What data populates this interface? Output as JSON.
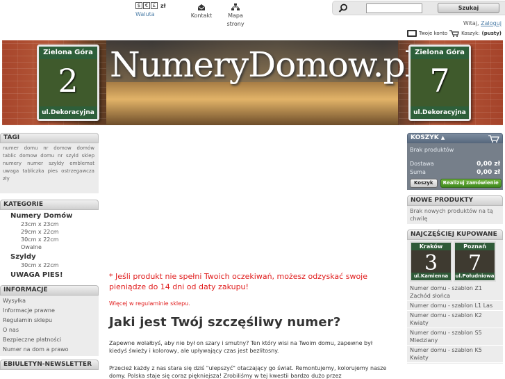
{
  "topbar": {
    "currency_symbols": [
      "$",
      "€",
      "£"
    ],
    "currency_active": "zł",
    "currency_label": "Waluta",
    "kontakt_label": "Kontakt",
    "mapa_line1": "Mapa",
    "mapa_line2": "strony",
    "search_placeholder": "",
    "search_button": "Szukaj",
    "welcome_text": "Witaj,",
    "login_link": "Zaloguj",
    "account_link": "Twoje konto",
    "cart_label": "Koszyk:",
    "cart_status": "(pusty)"
  },
  "banner": {
    "title": "NumeryDomow.pl",
    "left_plate": {
      "city": "Zielona Góra",
      "number": "2",
      "street": "ul.Dekoracyjna"
    },
    "right_plate": {
      "city": "Zielona Góra",
      "number": "7",
      "street": "ul.Dekoracyjna"
    }
  },
  "tags": {
    "title": "TAGI",
    "items": [
      "numer",
      "domu",
      "nr",
      "domow",
      "domów",
      "tablic",
      "domow",
      "domu",
      "nr",
      "szyld",
      "sklep",
      "numery",
      "numer",
      "szyldy",
      "emblemat",
      "uwaga",
      "tabliczka",
      "pies",
      "ostrzegawcza",
      "zły"
    ]
  },
  "categories": {
    "title": "KATEGORIE",
    "group1": {
      "label": "Numery Domów",
      "items": [
        "23cm x 23cm",
        "29cm x 22cm",
        "30cm x 22cm",
        "Owalne"
      ]
    },
    "group2": {
      "label": "Szyldy",
      "items": [
        "30cm x 22cm"
      ]
    },
    "group3": {
      "label": "UWAGA PIES!"
    }
  },
  "info": {
    "title": "INFORMACJE",
    "items": [
      "Wysyłka",
      "Informacje prawne",
      "Regulamin sklepu",
      "O nas",
      "Bezpieczne płatności",
      "Numer na dom a prawo"
    ]
  },
  "newsletter": {
    "title": "EBIULETYN-NEWSLETTER"
  },
  "cart": {
    "title": "KOSZYK",
    "empty": "Brak produktów",
    "delivery_label": "Dostawa",
    "delivery_value": "0,00 zł",
    "sum_label": "Suma",
    "sum_value": "0,00 zł",
    "cart_button": "Koszyk",
    "order_button": "Realizuj zamówienie"
  },
  "new_products": {
    "title": "NOWE PRODUKTY",
    "text": "Brak nowych produktów na tą chwilę"
  },
  "popular": {
    "title": "NAJCZĘŚCIEJ KUPOWANE",
    "plate1": {
      "city": "Kraków",
      "number": "3",
      "street": "ul.Kamienna"
    },
    "plate2": {
      "city": "Poznań",
      "number": "7",
      "street": "ul.Południowa"
    },
    "items": [
      "Numer domu - szablon Z1 Zachód słońca",
      "Numer domu - szablon L1 Las",
      "Numer domu - szablon K2 Kwiaty",
      "Numer domu - szablon S5 Miedziany",
      "Numer domu - szablon K5 Kwiaty"
    ]
  },
  "main": {
    "guarantee": "* Jeśli produkt nie spełni Twoich oczekiwań, możesz odzyskać swoje pieniądze do 14 dni od daty zakupu!",
    "more": "Więcej w regulaminie sklepu.",
    "headline": "Jaki jest Twój szczęśliwy numer?",
    "para1": "Zapewne wolałbyś, aby nie był on szary i smutny? Ten który wisi na Twoim domu, zapewne był kiedyś świeży i kolorowy, ale upływający czas jest bezlitosny.",
    "para2": "Przecież każdy z nas stara się dziś \"ulepszyć\" otaczający go świat. Remontujemy, kolorujemy nasze domy. Polska staje się coraz piękniejsza! Zrobiliśmy w tej kwestii bardzo dużo przez"
  }
}
